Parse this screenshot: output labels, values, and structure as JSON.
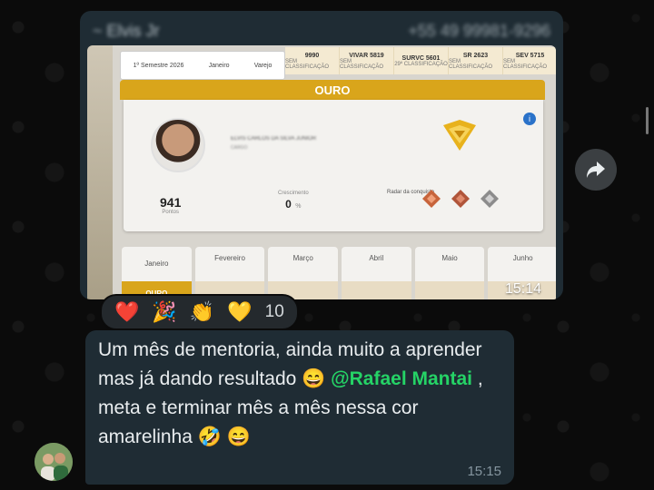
{
  "image_message": {
    "sender_name": "~ Elvis Jr",
    "sender_phone": "+55 49 99981-9296",
    "time": "15:14",
    "photo": {
      "filters": [
        "1º Semestre 2026",
        "Janeiro",
        "Varejo"
      ],
      "scores": [
        {
          "value": "9990",
          "label": "SEM CLASSIFICAÇÃO"
        },
        {
          "value": "VIVAR 5819",
          "label": "SEM CLASSIFICAÇÃO"
        },
        {
          "value": "SURVC 5601",
          "label": "29º CLASSIFICAÇÃO"
        },
        {
          "value": "SR 2623",
          "label": "SEM CLASSIFICAÇÃO"
        },
        {
          "value": "SEV 5715",
          "label": "SEM CLASSIFICAÇÃO"
        }
      ],
      "tier_title": "OURO",
      "person_name": "ELVIS CARLOS DA SILVA JUNIOR",
      "person_role": "CARGO",
      "points_value": "941",
      "points_label": "Pontos",
      "growth_label": "Crescimento",
      "growth_value": "0",
      "growth_unit": "%",
      "radar_label": "Radar da conquista",
      "months": [
        "Janeiro",
        "Fevereiro",
        "Março",
        "Abril",
        "Maio",
        "Junho"
      ],
      "month_tier": "OURO"
    }
  },
  "reactions": {
    "emojis": [
      "❤️",
      "🎉",
      "👏",
      "💛"
    ],
    "count": "10"
  },
  "text_message": {
    "line1": "Um mês de mentoria, ainda muito a aprender mas já dando resultado 😄",
    "mention": "@Rafael Mantai",
    "line2": " , meta e terminar mês a mês nessa cor amarelinha 🤣 😄",
    "time": "15:15"
  },
  "colors": {
    "bubble": "#1f2c34",
    "mention": "#25d366",
    "gold": "#d9a51b"
  },
  "icons": {
    "forward": "forward-icon",
    "info": "info-icon"
  }
}
